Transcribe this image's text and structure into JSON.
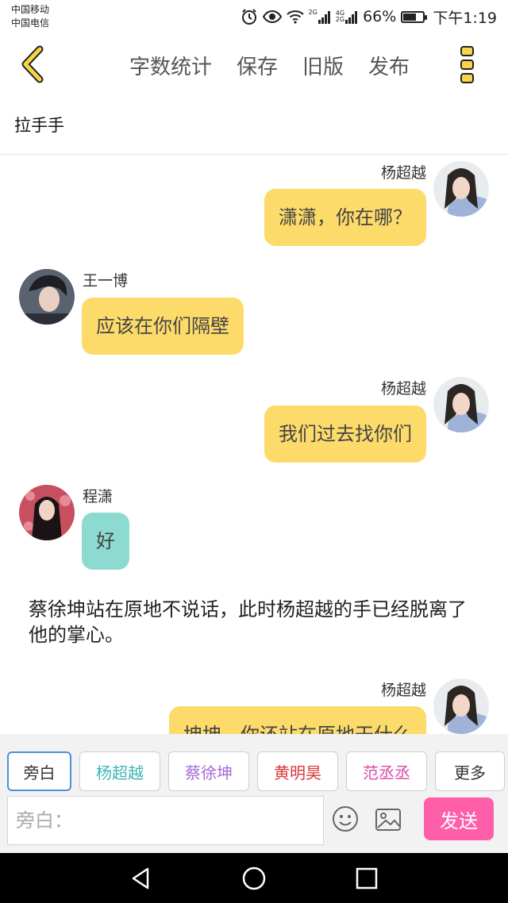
{
  "status_bar": {
    "carrier_1": "中国移动",
    "carrier_2": "中国电信",
    "net_1": "2G",
    "net_2": "4G",
    "net_3": "2G",
    "battery": "66%",
    "battery_level": 0.66,
    "time": "下午1:19"
  },
  "toolbar": {
    "back_icon": "chevron-left-icon",
    "actions": [
      "字数统计",
      "保存",
      "旧版",
      "发布"
    ],
    "more_icon": "more-dots-icon"
  },
  "document": {
    "title": "拉手手"
  },
  "messages": [
    {
      "speaker": "杨超越",
      "text": "潇潇，你在哪？",
      "side": "right",
      "color": "#fddb6a"
    },
    {
      "speaker": "王一博",
      "text": "应该在你们隔壁",
      "side": "left",
      "color": "#fddb6a"
    },
    {
      "speaker": "杨超越",
      "text": "我们过去找你们",
      "side": "right",
      "color": "#fddb6a"
    },
    {
      "speaker": "程潇",
      "text": "好",
      "side": "left",
      "color": "#8ddbd0"
    },
    {
      "narration": "蔡徐坤站在原地不说话，此时杨超越的手已经脱离了他的掌心。"
    },
    {
      "speaker": "杨超越",
      "text": "坤坤，你还站在原地干什么",
      "side": "right",
      "color": "#fddb6a"
    }
  ],
  "roles": [
    {
      "label": "旁白",
      "color": "#333333"
    },
    {
      "label": "杨超越",
      "color": "#3fb6b6"
    },
    {
      "label": "蔡徐坤",
      "color": "#a66bd4"
    },
    {
      "label": "黄明昊",
      "color": "#d9383a"
    },
    {
      "label": "范丞丞",
      "color": "#d94aa6"
    },
    {
      "label": "更多",
      "color": "#333333"
    }
  ],
  "composer": {
    "placeholder": "旁白：",
    "send_label": "发送",
    "emoji_icon": "emoji-icon",
    "image_icon": "image-icon"
  },
  "nav": {
    "back_icon": "nav-back-icon",
    "home_icon": "nav-home-icon",
    "recents_icon": "nav-recents-icon"
  }
}
